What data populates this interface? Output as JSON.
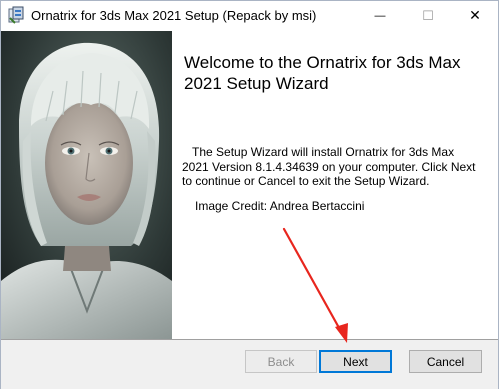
{
  "window": {
    "title": "Ornatrix for 3ds Max 2021 Setup (Repack by msi)",
    "app_icon": "installer-icon",
    "controls": {
      "minimize_glyph": "—",
      "maximize_glyph": "☐",
      "close_glyph": "✕"
    }
  },
  "hero": {
    "description_icon": "portrait-image"
  },
  "content": {
    "heading": "Welcome to the Ornatrix for 3ds Max 2021 Setup Wizard",
    "description": "The Setup Wizard will install Ornatrix for 3ds Max 2021 Version 8.1.4.34639 on your computer. Click Next to continue or Cancel to exit the Setup Wizard.",
    "credit": "Image Credit: Andrea Bertaccini"
  },
  "footer": {
    "back_label": "Back",
    "next_label": "Next",
    "cancel_label": "Cancel"
  },
  "colors": {
    "focus_border": "#0078d7",
    "annotation_arrow": "#e8261e",
    "footer_bg": "#f0f0f0"
  }
}
